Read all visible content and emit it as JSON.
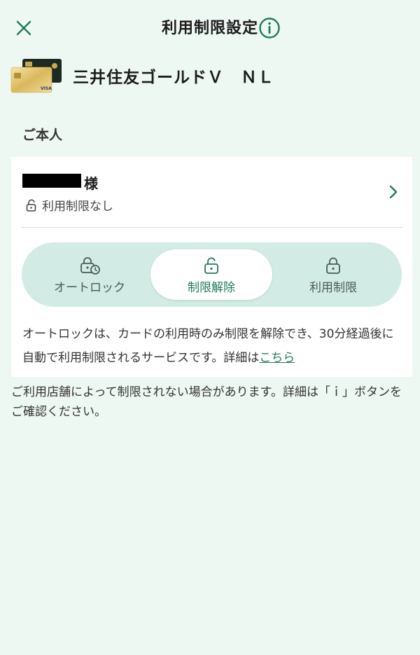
{
  "header": {
    "title": "利用制限設定"
  },
  "card": {
    "name": "三井住友ゴールドＶ　ＮＬ",
    "brand_mark": "VISA"
  },
  "section": {
    "label": "ご本人"
  },
  "member": {
    "honorific": "様",
    "status": "利用制限なし"
  },
  "segments": [
    {
      "label": "オートロック",
      "icon": "auto-lock-icon",
      "selected": false
    },
    {
      "label": "制限解除",
      "icon": "unlock-icon",
      "selected": true
    },
    {
      "label": "利用制限",
      "icon": "lock-icon",
      "selected": false
    }
  ],
  "description": {
    "text": "オートロックは、カードの利用時のみ制限を解除でき、30分経過後に自動で利用制限されるサービスです。詳細は",
    "link": "こちら"
  },
  "note": "ご利用店舗によって制限されない場合があります。詳細は「ｉ」ボタンをご確認ください。",
  "colors": {
    "accent": "#1f7a5a",
    "background": "#eef8f3",
    "segment_track": "#d2ebe4"
  }
}
